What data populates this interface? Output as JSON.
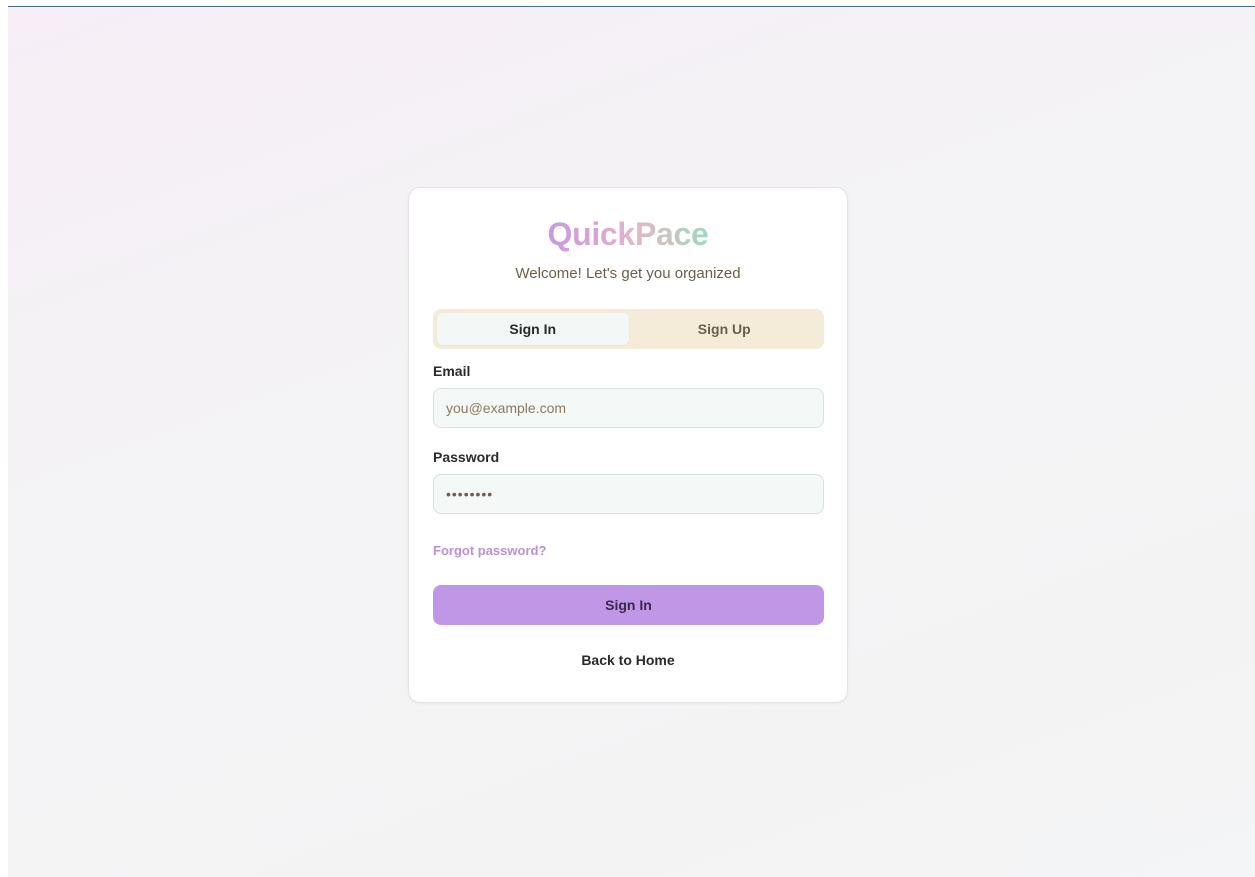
{
  "brand": {
    "part1": "Quick",
    "part2": "Pace",
    "colors": {
      "q": "#c99ae0",
      "uick_start": "#c99ae0",
      "uick_end": "#e6b6c8",
      "pace_start": "#e0b8c6",
      "pace_end": "#9fd8bf"
    }
  },
  "subtitle": "Welcome! Let's get you organized",
  "tabs": [
    {
      "label": "Sign In",
      "active": true
    },
    {
      "label": "Sign Up",
      "active": false
    }
  ],
  "form": {
    "email_label": "Email",
    "email_placeholder": "you@example.com",
    "email_value": "",
    "password_label": "Password",
    "password_value": "••••••••"
  },
  "forgot_link": "Forgot password?",
  "submit_label": "Sign In",
  "back_link": "Back to Home",
  "colors": {
    "accent": "#c097e6",
    "tab_bg": "#f4ecd8",
    "link": "#b892d8"
  }
}
